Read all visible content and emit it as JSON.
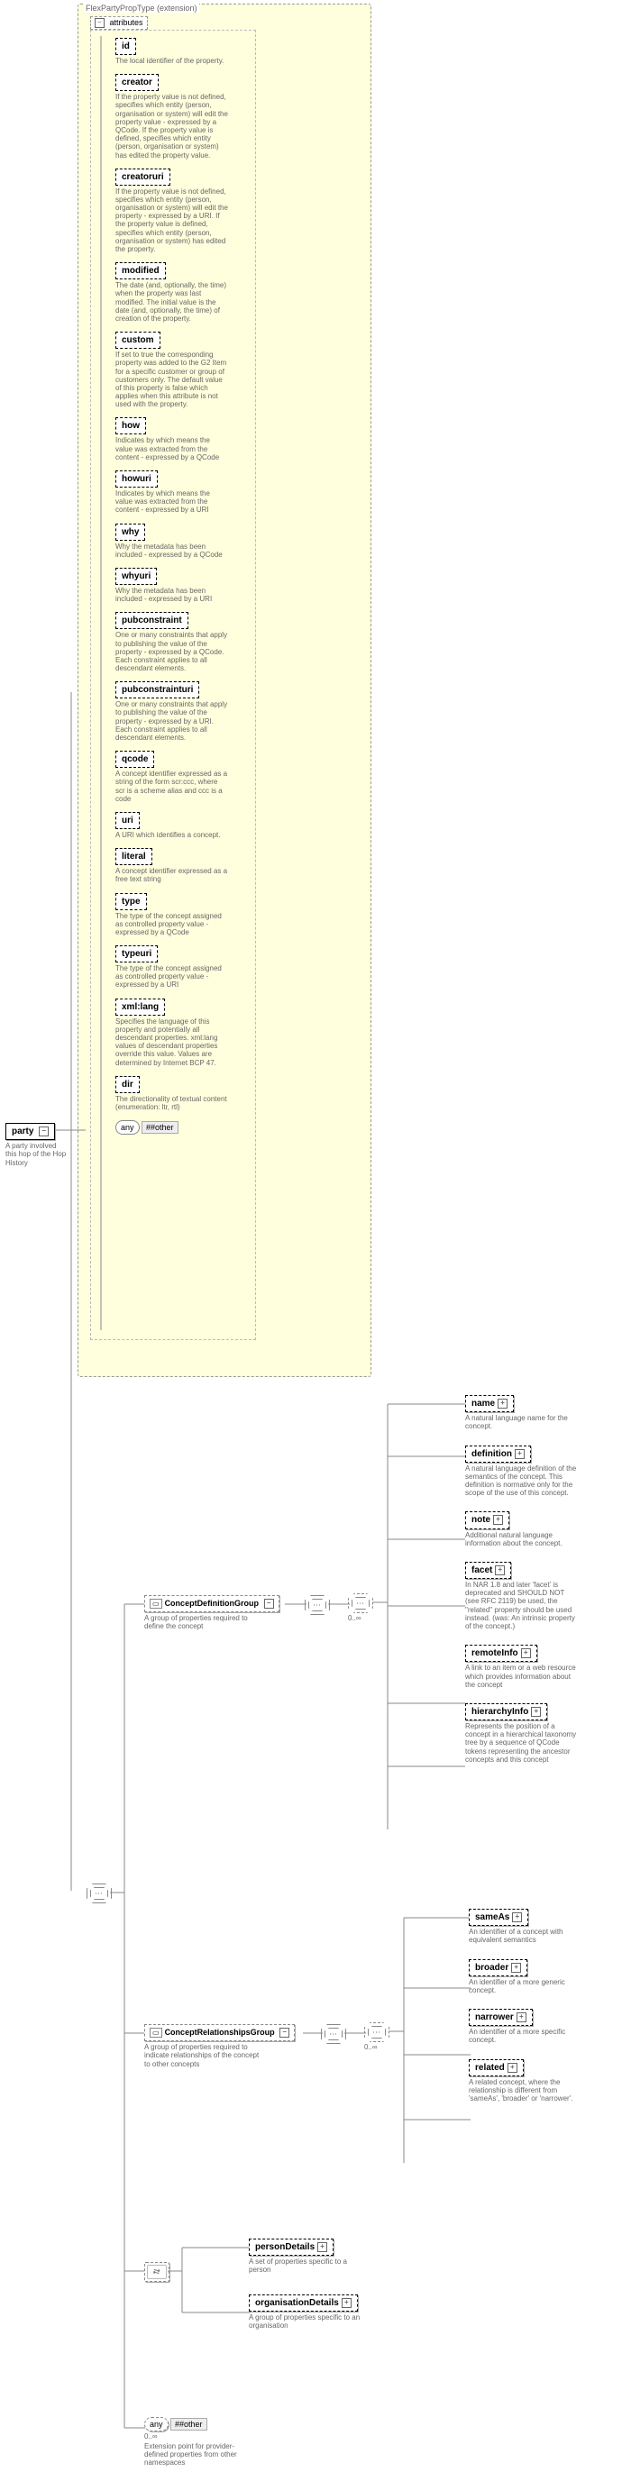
{
  "extension_label": "FlexPartyPropType (extension)",
  "attributes_label": "attributes",
  "root": {
    "name": "party",
    "desc": "A party involved this hop of the Hop History"
  },
  "attrs": [
    {
      "name": "id",
      "desc": "The local identifier of the property."
    },
    {
      "name": "creator",
      "desc": "If the property value is not defined, specifies which entity (person, organisation or system) will edit the property value - expressed by a QCode. If the property value is defined, specifies which entity (person, organisation or system) has edited the property value."
    },
    {
      "name": "creatoruri",
      "desc": "If the property value is not defined, specifies which entity (person, organisation or system) will edit the property - expressed by a URI. If the property value is defined, specifies which entity (person, organisation or system) has edited the property."
    },
    {
      "name": "modified",
      "desc": "The date (and, optionally, the time) when the property was last modified. The initial value is the date (and, optionally, the time) of creation of the property."
    },
    {
      "name": "custom",
      "desc": "If set to true the corresponding property was added to the G2 Item for a specific customer or group of customers only. The default value of this property is false which applies when this attribute is not used with the property."
    },
    {
      "name": "how",
      "desc": "Indicates by which means the value was extracted from the content - expressed by a QCode"
    },
    {
      "name": "howuri",
      "desc": "Indicates by which means the value was extracted from the content - expressed by a URI"
    },
    {
      "name": "why",
      "desc": "Why the metadata has been included - expressed by a QCode"
    },
    {
      "name": "whyuri",
      "desc": "Why the metadata has been included - expressed by a URI"
    },
    {
      "name": "pubconstraint",
      "desc": "One or many constraints that apply to publishing the value of the property - expressed by a QCode. Each constraint applies to all descendant elements."
    },
    {
      "name": "pubconstrainturi",
      "desc": "One or many constraints that apply to publishing the value of the property - expressed by a URI. Each constraint applies to all descendant elements."
    },
    {
      "name": "qcode",
      "desc": "A concept identifier expressed as a string of the form scr:ccc, where scr is a scheme alias and ccc is a code"
    },
    {
      "name": "uri",
      "desc": "A URI which identifies a concept."
    },
    {
      "name": "literal",
      "desc": "A concept identifier expressed as a free text string"
    },
    {
      "name": "type",
      "desc": "The type of the concept assigned as controlled property value - expressed by a QCode"
    },
    {
      "name": "typeuri",
      "desc": "The type of the concept assigned as controlled property value - expressed by a URI"
    },
    {
      "name": "xml:lang",
      "desc": "Specifies the language of this property and potentially all descendant properties. xml:lang values of descendant properties override this value. Values are determined by Internet BCP 47."
    },
    {
      "name": "dir",
      "desc": "The directionality of textual content (enumeration: ltr, rtl)"
    }
  ],
  "any_attr": {
    "any": "any",
    "other": "##other"
  },
  "groups": {
    "defn": {
      "name": "ConceptDefinitionGroup",
      "desc": "A group of properties required to define the concept"
    },
    "rels": {
      "name": "ConceptRelationshipsGroup",
      "desc": "A group of properties required to indicate relationships of the concept to other concepts"
    }
  },
  "defn_children": [
    {
      "name": "name",
      "desc": "A natural language name for the concept."
    },
    {
      "name": "definition",
      "desc": "A natural language definition of the semantics of the concept. This definition is normative only for the scope of the use of this concept."
    },
    {
      "name": "note",
      "desc": "Additional natural language information about the concept."
    },
    {
      "name": "facet",
      "desc": "In NAR 1.8 and later 'facet' is deprecated and SHOULD NOT (see RFC 2119) be used, the \"related\" property should be used instead. (was: An intrinsic property of the concept.)"
    },
    {
      "name": "remoteInfo",
      "desc": "A link to an item or a web resource which provides information about the concept"
    },
    {
      "name": "hierarchyInfo",
      "desc": "Represents the position of a concept in a hierarchical taxonomy tree by a sequence of QCode tokens representing the ancestor concepts and this concept"
    }
  ],
  "rels_children": [
    {
      "name": "sameAs",
      "desc": "An identifier of a concept with equivalent semantics"
    },
    {
      "name": "broader",
      "desc": "An identifier of a more generic concept."
    },
    {
      "name": "narrower",
      "desc": "An identifier of a more specific concept."
    },
    {
      "name": "related",
      "desc": "A related concept, where the relationship is different from 'sameAs', 'broader' or 'narrower'."
    }
  ],
  "choice": [
    {
      "name": "personDetails",
      "desc": "A set of properties specific to a person"
    },
    {
      "name": "organisationDetails",
      "desc": "A group of properties specific to an organisation"
    }
  ],
  "bottom_any": {
    "any": "any",
    "other": "##other",
    "desc": "Extension point for provider-defined properties from other namespaces",
    "occ": "0..∞"
  },
  "occ_unbounded": "0..∞"
}
